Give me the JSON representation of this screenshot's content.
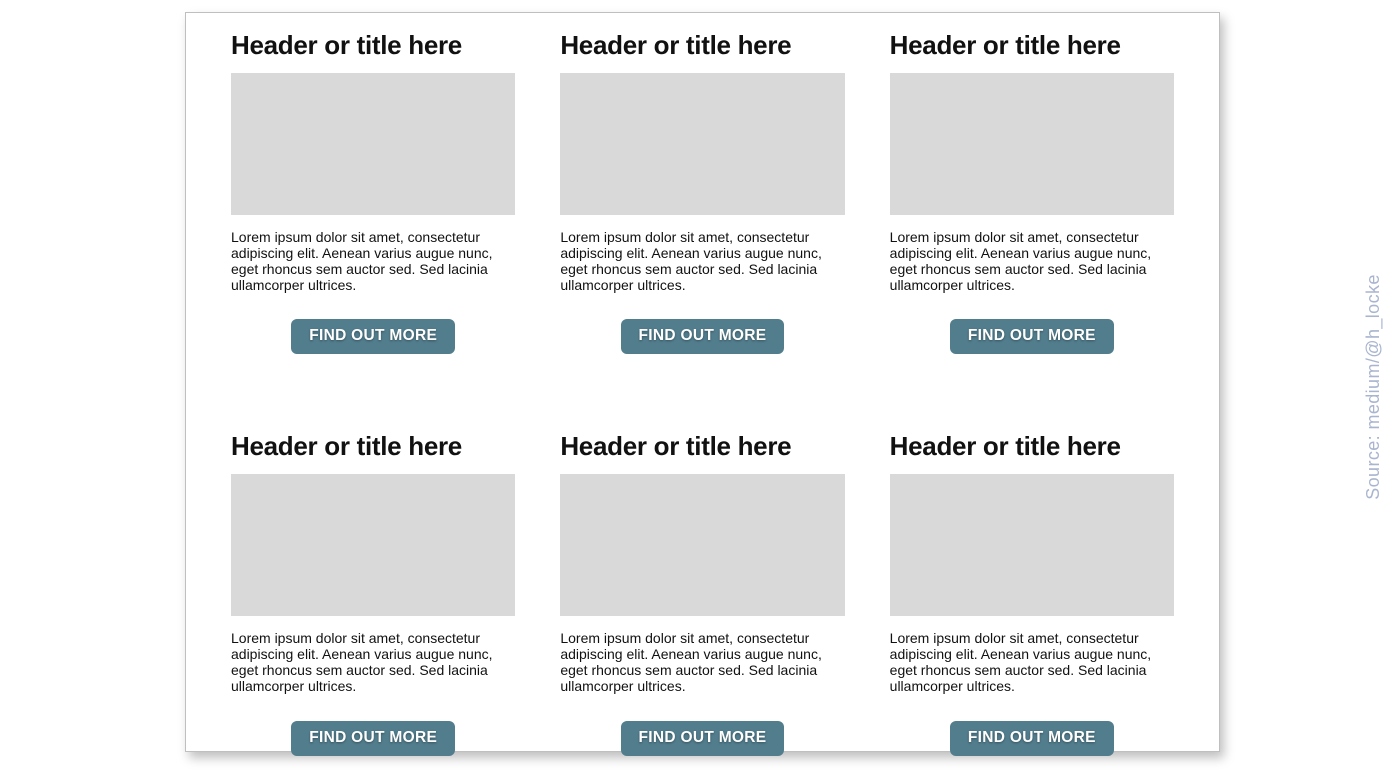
{
  "source_label": "Source: medium/@h_locke",
  "cards": [
    {
      "title": "Header or title here",
      "body": "Lorem ipsum dolor sit amet, consectetur adipiscing elit. Aenean varius augue nunc, eget rhoncus sem auctor sed. Sed lacinia ullamcorper ultrices.",
      "button": "FIND OUT MORE"
    },
    {
      "title": "Header or title here",
      "body": "Lorem ipsum dolor sit amet, consectetur adipiscing elit. Aenean varius augue nunc, eget rhoncus sem auctor sed. Sed lacinia ullamcorper ultrices.",
      "button": "FIND OUT MORE"
    },
    {
      "title": "Header or title here",
      "body": "Lorem ipsum dolor sit amet, consectetur adipiscing elit. Aenean varius augue nunc, eget rhoncus sem auctor sed. Sed lacinia ullamcorper ultrices.",
      "button": "FIND OUT MORE"
    },
    {
      "title": "Header or title here",
      "body": "Lorem ipsum dolor sit amet, consectetur adipiscing elit. Aenean varius augue nunc, eget rhoncus sem auctor sed. Sed lacinia ullamcorper ultrices.",
      "button": "FIND OUT MORE"
    },
    {
      "title": "Header or title here",
      "body": "Lorem ipsum dolor sit amet, consectetur adipiscing elit. Aenean varius augue nunc, eget rhoncus sem auctor sed. Sed lacinia ullamcorper ultrices.",
      "button": "FIND OUT MORE"
    },
    {
      "title": "Header or title here",
      "body": "Lorem ipsum dolor sit amet, consectetur adipiscing elit. Aenean varius augue nunc, eget rhoncus sem auctor sed. Sed lacinia ullamcorper ultrices.",
      "button": "FIND OUT MORE"
    }
  ]
}
